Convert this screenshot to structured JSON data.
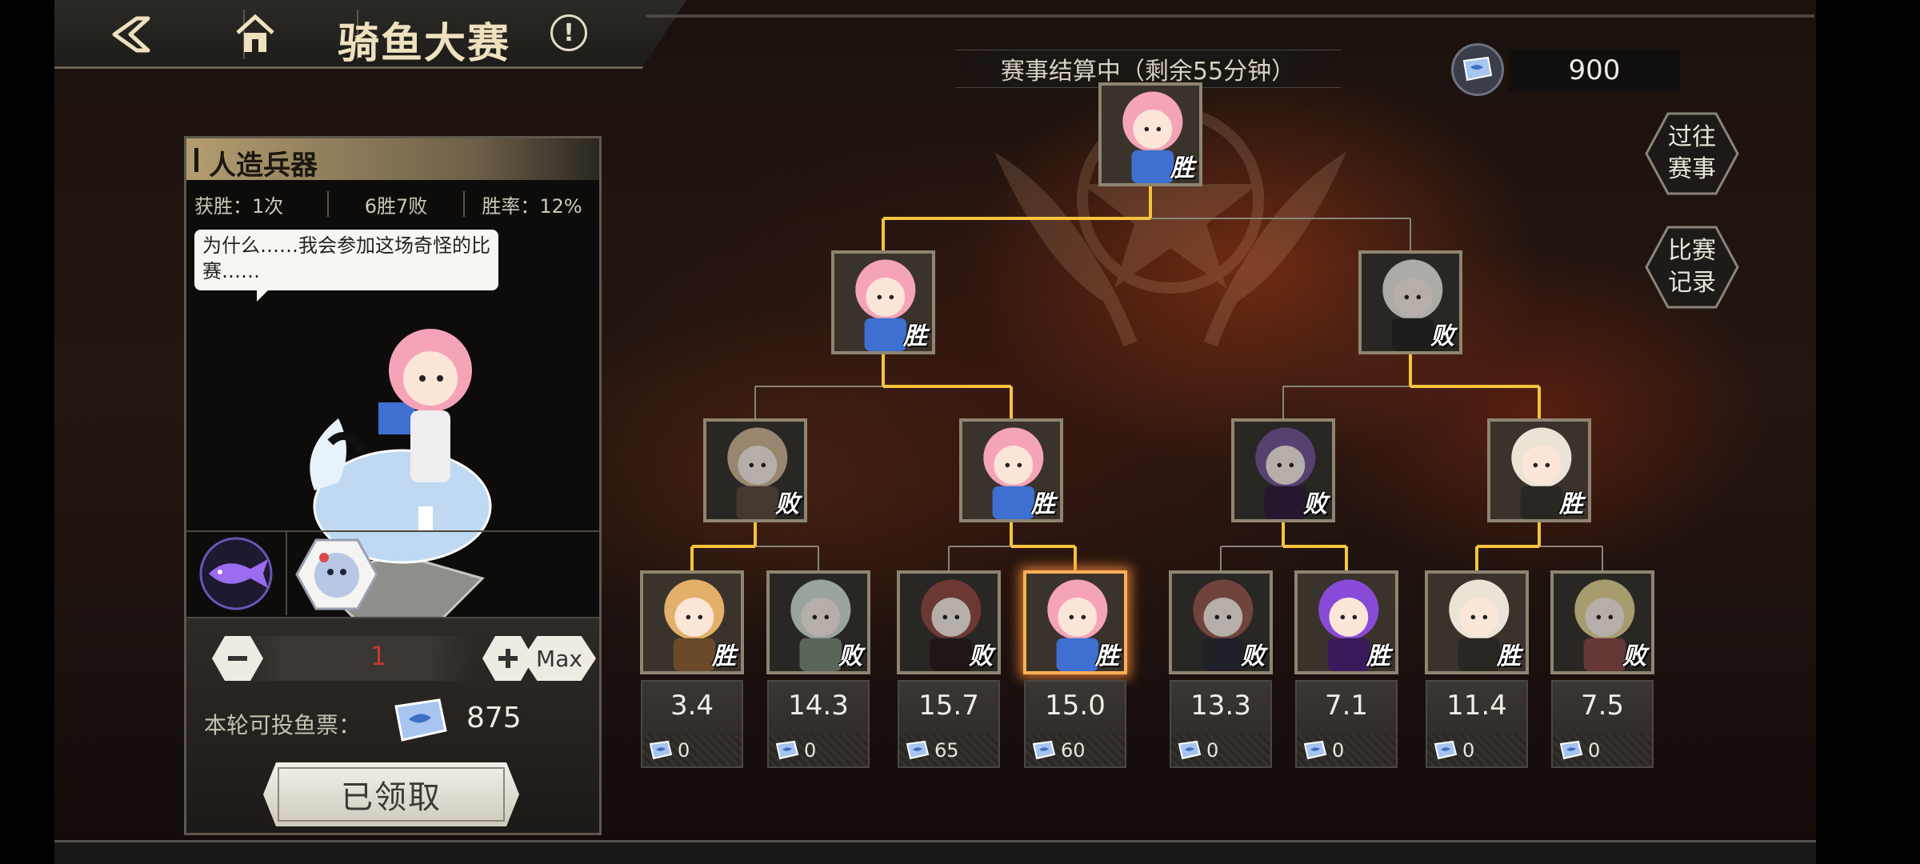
{
  "header": {
    "title": "骑鱼大赛",
    "info": "!"
  },
  "status": {
    "text": "赛事结算中（剩余55分钟）"
  },
  "currency": {
    "amount": "900",
    "icon": "fish-ticket-icon"
  },
  "side_buttons": {
    "past": "过往\n赛事",
    "record": "比赛\n记录"
  },
  "side_buttons_lines": {
    "past": [
      "过往",
      "赛事"
    ],
    "record": [
      "比赛",
      "记录"
    ]
  },
  "panel": {
    "name": "人造兵器",
    "wins": "获胜：1次",
    "record": "6胜7败",
    "rate": "胜率：12%",
    "speech": "为什么……我会参加这场奇怪的比赛……",
    "quantity": "1",
    "max_label": "Max",
    "bet_label": "本轮可投鱼票：",
    "bet_count": "875",
    "claim_label": "已领取"
  },
  "bracket": {
    "final": {
      "result": "胜"
    },
    "semis": [
      {
        "result": "胜"
      },
      {
        "result": "败"
      }
    ],
    "quarters": [
      {
        "result": "败"
      },
      {
        "result": "胜"
      },
      {
        "result": "败"
      },
      {
        "result": "胜"
      }
    ],
    "round1": [
      {
        "result": "胜",
        "odds": "3.4",
        "bets": "0"
      },
      {
        "result": "败",
        "odds": "14.3",
        "bets": "0"
      },
      {
        "result": "败",
        "odds": "15.7",
        "bets": "65"
      },
      {
        "result": "胜",
        "odds": "15.0",
        "bets": "60",
        "selected": true
      },
      {
        "result": "败",
        "odds": "13.3",
        "bets": "0"
      },
      {
        "result": "胜",
        "odds": "7.1",
        "bets": "0"
      },
      {
        "result": "胜",
        "odds": "11.4",
        "bets": "0"
      },
      {
        "result": "败",
        "odds": "7.5",
        "bets": "0"
      }
    ]
  },
  "colors": {
    "win_line": "#f5c43a",
    "lose_line": "#8a847a",
    "accent": "#efe1be",
    "selected": "#ffb055"
  }
}
